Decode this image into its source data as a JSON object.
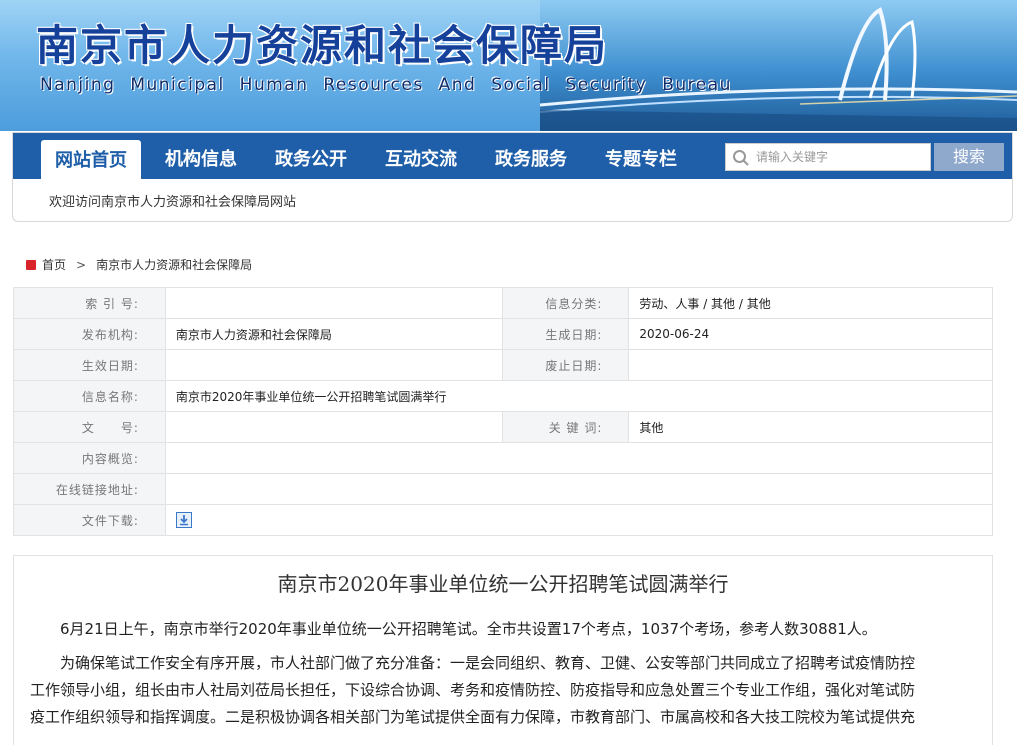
{
  "header": {
    "title_cn": "南京市人力资源和社会保障局",
    "title_en": "Nanjing Municipal Human Resources And Social Security Bureau"
  },
  "nav": {
    "items": [
      "网站首页",
      "机构信息",
      "政务公开",
      "互动交流",
      "政务服务",
      "专题专栏"
    ],
    "active_index": 0,
    "search_placeholder": "请输入关键字",
    "search_button": "搜索"
  },
  "welcome": "欢迎访问南京市人力资源和社会保障局网站",
  "breadcrumb": [
    "首页",
    "南京市人力资源和社会保障局"
  ],
  "meta": {
    "index_label": "索 引 号:",
    "index_value": "",
    "category_label": "信息分类:",
    "category_value": "劳动、人事 / 其他 / 其他",
    "publisher_label": "发布机构:",
    "publisher_value": "南京市人力资源和社会保障局",
    "created_label": "生成日期:",
    "created_value": "2020-06-24",
    "effective_label": "生效日期:",
    "effective_value": "",
    "expired_label": "废止日期:",
    "expired_value": "",
    "name_label": "信息名称:",
    "name_value": "南京市2020年事业单位统一公开招聘笔试圆满举行",
    "doc_label": "文　　号:",
    "doc_value": "",
    "keywords_label": "关 键 词:",
    "keywords_value": "其他",
    "summary_label": "内容概览:",
    "summary_value": "",
    "link_label": "在线链接地址:",
    "link_value": "",
    "download_label": "文件下载:"
  },
  "article": {
    "title": "南京市2020年事业单位统一公开招聘笔试圆满举行",
    "p1": "6月21日上午，南京市举行2020年事业单位统一公开招聘笔试。全市共设置17个考点，1037个考场，参考人数30881人。",
    "p2_line1": "为确保笔试工作安全有序开展，市人社部门做了充分准备：一是会同组织、教育、卫健、公安等部门共同成立了招聘考试疫情防控",
    "p2_line2": "工作领导小组，组长由市人社局刘莅局长担任，下设综合协调、考务和疫情防控、防疫指导和应急处置三个专业工作组，强化对笔试防",
    "p2_line3": "疫工作组织领导和指挥调度。二是积极协调各相关部门为笔试提供全面有力保障，市教育部门、市属高校和各大技工院校为笔试提供充"
  },
  "colors": {
    "nav_bg": "#1f5ea8",
    "title_blue": "#16419a",
    "accent_red": "#d9252a"
  },
  "icons": [
    "search-icon",
    "home-icon",
    "download-icon"
  ]
}
